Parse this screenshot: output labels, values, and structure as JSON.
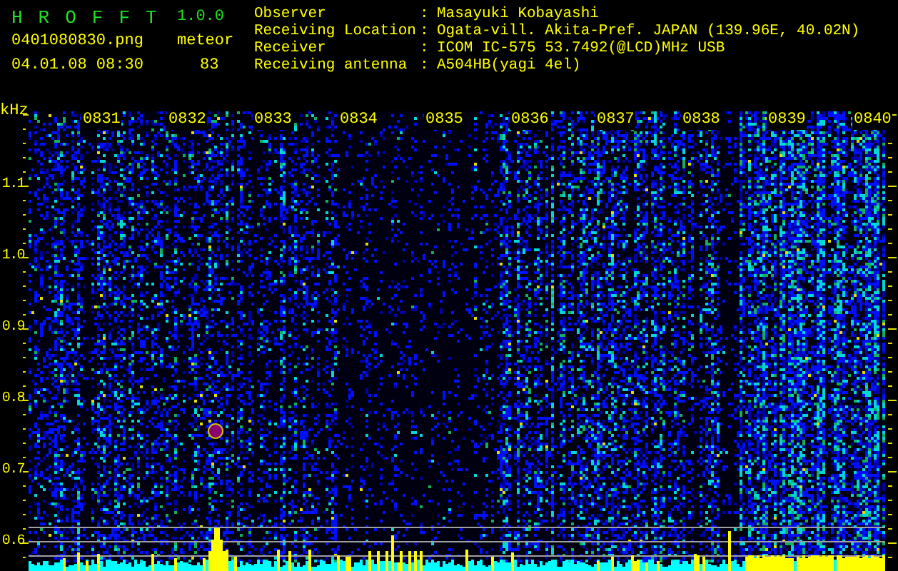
{
  "app": {
    "title": "H R O F F T",
    "version": "1.0.0",
    "filename": "0401080830.png",
    "datetime": "04.01.08 08:30"
  },
  "counter": {
    "label": "meteor",
    "value": "83"
  },
  "station_info": [
    {
      "label": "Observer",
      "separator": ":",
      "value": "Masayuki Kobayashi"
    },
    {
      "label": "Receiving Location",
      "separator": ":",
      "value": "Ogata-vill. Akita-Pref. JAPAN (139.96E, 40.02N)"
    },
    {
      "label": "Receiver",
      "separator": ":",
      "value": "ICOM IC-575 53.7492(@LCD)MHz USB"
    },
    {
      "label": "Receiving antenna",
      "separator": ":",
      "value": "A504HB(yagi 4el)"
    }
  ],
  "spectrogram": {
    "y_unit": "kHz",
    "y_labels": [
      "1.1",
      "1.0",
      "0.9",
      "0.8",
      "0.7",
      "0.6"
    ],
    "time_labels": [
      "0831",
      "0832",
      "0833",
      "0834",
      "0835",
      "0836",
      "0837",
      "0838",
      "0839",
      "0840"
    ]
  }
}
